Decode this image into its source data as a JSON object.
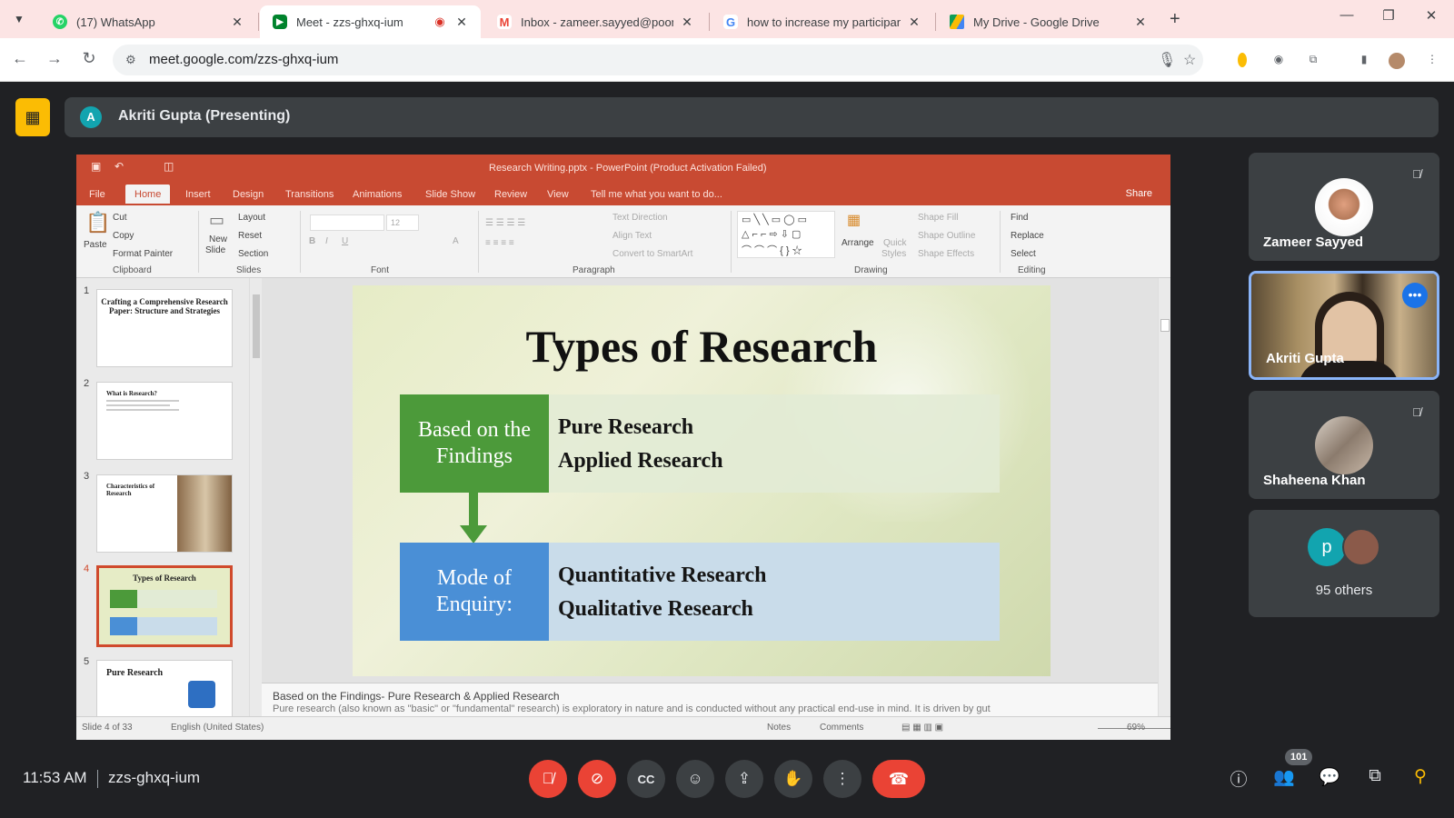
{
  "browser": {
    "tabs": [
      {
        "title": "(17) WhatsApp",
        "icon": "whatsapp-icon",
        "color": "#25d366"
      },
      {
        "title": "Meet - zzs-ghxq-ium",
        "icon": "meet-icon",
        "color": "#00832d",
        "active": true
      },
      {
        "title": "Inbox - zameer.sayyed@poona",
        "icon": "gmail-icon",
        "color": "#ea4335"
      },
      {
        "title": "how to increase my participant",
        "icon": "google-icon",
        "color": "#4285f4"
      },
      {
        "title": "My Drive - Google Drive",
        "icon": "drive-icon",
        "color": "#fbbc04"
      }
    ],
    "url": "meet.google.com/zzs-ghxq-ium"
  },
  "meet": {
    "presenter_initial": "A",
    "presenter_label": "Akriti Gupta (Presenting)",
    "time": "11:53 AM",
    "code": "zzs-ghxq-ium",
    "people_badge": "101",
    "tiles": [
      {
        "name": "Zameer Sayyed",
        "muted": true
      },
      {
        "name": "Akriti Gupta",
        "speaking": true
      },
      {
        "name": "Shaheena Khan",
        "muted": true
      },
      {
        "name": "95 others",
        "initial": "p"
      }
    ]
  },
  "powerpoint": {
    "doc_title": "Research Writing.pptx - PowerPoint (Product Activation Failed)",
    "tabs": [
      "File",
      "Home",
      "Insert",
      "Design",
      "Transitions",
      "Animations",
      "Slide Show",
      "Review",
      "View"
    ],
    "tell_me": "Tell me what you want to do...",
    "share": "Share",
    "ribbon": {
      "paste": "Paste",
      "cut": "Cut",
      "copy": "Copy",
      "format_painter": "Format Painter",
      "new_slide": "New",
      "new_slide2": "Slide",
      "layout": "Layout",
      "reset": "Reset",
      "section": "Section",
      "font_size": "12",
      "text_direction": "Text Direction",
      "align_text": "Align Text",
      "convert": "Convert to SmartArt",
      "arrange": "Arrange",
      "quick_styles": "Quick",
      "quick_styles2": "Styles",
      "shape_fill": "Shape Fill",
      "shape_outline": "Shape Outline",
      "shape_effects": "Shape Effects",
      "find": "Find",
      "replace": "Replace",
      "select": "Select",
      "groups": [
        "Clipboard",
        "Slides",
        "Font",
        "Paragraph",
        "Drawing",
        "Editing"
      ]
    },
    "thumbnails": [
      {
        "num": "1",
        "title": "Crafting a Comprehensive Research Paper: Structure and Strategies"
      },
      {
        "num": "2",
        "title": "What is Research?"
      },
      {
        "num": "3",
        "title": "Characteristics of Research"
      },
      {
        "num": "4",
        "title": "Types of Research"
      },
      {
        "num": "5",
        "title": "Pure Research"
      }
    ],
    "slide": {
      "title": "Types of Research",
      "row1_label": "Based on the Findings",
      "row1_items": [
        "Pure Research",
        "Applied Research"
      ],
      "row2_label": "Mode of Enquiry:",
      "row2_items": [
        "Quantitative Research",
        "Qualitative Research"
      ]
    },
    "notes_line1": "Based on the Findings- Pure Research & Applied Research",
    "notes_line2": "Pure research (also known as \"basic\" or \"fundamental\" research) is exploratory in nature and is conducted without any practical end-use in mind. It is driven by gut",
    "status": {
      "slide": "Slide 4 of 33",
      "language": "English (United States)",
      "notes": "Notes",
      "comments": "Comments",
      "zoom": "69%"
    }
  }
}
